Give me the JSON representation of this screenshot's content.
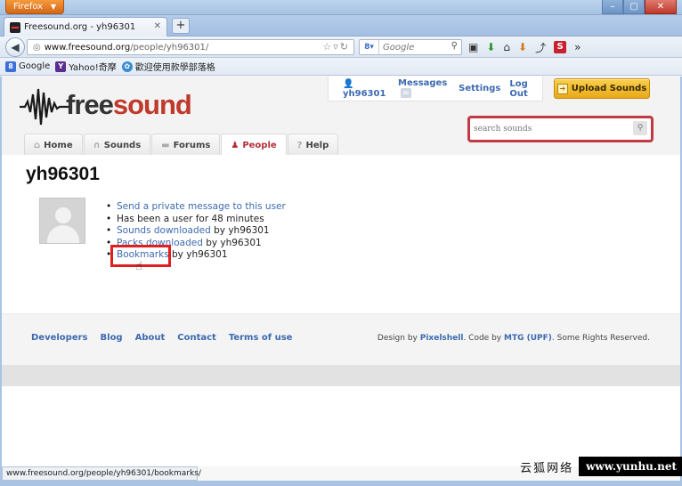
{
  "browser": {
    "app_button": "Firefox",
    "tab_title": "Freesound.org - yh96301",
    "new_tab": "+",
    "url_host": "www.freesound.org",
    "url_path": "/people/yh96301/",
    "search_engine_placeholder": "Google",
    "status_url": "www.freesound.org/people/yh96301/bookmarks/",
    "bookmarks": [
      {
        "label": "Google"
      },
      {
        "label": "Yahoo!奇摩"
      },
      {
        "label": "歡迎使用款學部落格"
      }
    ]
  },
  "site": {
    "logo": "freesound",
    "userbar": {
      "username": "yh96301",
      "messages": "Messages",
      "settings": "Settings",
      "logout": "Log Out"
    },
    "upload_button": "Upload Sounds",
    "search_placeholder": "search sounds",
    "nav": [
      {
        "label": "Home",
        "icon": "home-icon"
      },
      {
        "label": "Sounds",
        "icon": "headphones-icon"
      },
      {
        "label": "Forums",
        "icon": "speech-bubble-icon"
      },
      {
        "label": "People",
        "icon": "people-icon",
        "active": true
      },
      {
        "label": "Help",
        "icon": "help-icon"
      }
    ]
  },
  "profile": {
    "username": "yh96301",
    "send_message": "Send a private message to this user",
    "member_for": "Has been a user for 48 minutes",
    "sounds_link": "Sounds downloaded",
    "packs_link": "Packs downloaded",
    "bookmarks_link": "Bookmarks",
    "by_suffix": " by yh96301"
  },
  "footer": {
    "links": [
      "Developers",
      "Blog",
      "About",
      "Contact",
      "Terms of use"
    ],
    "credit_prefix": "Design by ",
    "credit_design": "Pixelshell",
    "credit_mid": ". Code by ",
    "credit_code": "MTG (UPF)",
    "credit_suffix": ". Some Rights Reserved."
  },
  "watermark": {
    "cn": "云狐网络",
    "url": "www.yunhu.net"
  },
  "colors": {
    "accent_red": "#c03a43",
    "link_blue": "#3c6ab0",
    "upload_yellow": "#f2bc2e"
  }
}
